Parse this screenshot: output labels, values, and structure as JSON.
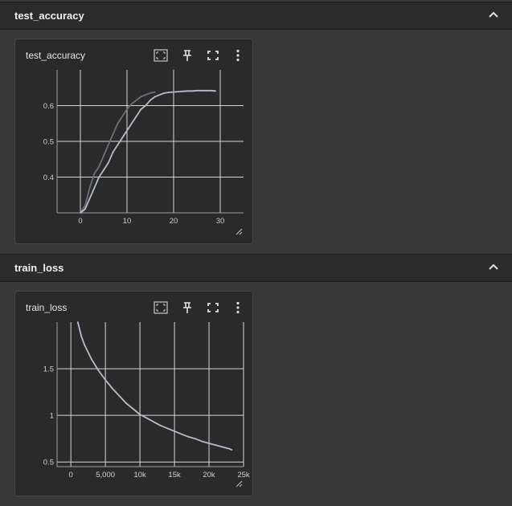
{
  "sections": [
    {
      "title": "test_accuracy"
    },
    {
      "title": "train_loss"
    }
  ],
  "cards": [
    {
      "title": "test_accuracy",
      "toolbar": {
        "fit": "fit-domain-icon",
        "pin": "pin-icon",
        "fullscreen": "fullscreen-icon",
        "more": "more-vert-icon"
      },
      "chart_data": {
        "type": "line",
        "title": "",
        "xlabel": "",
        "ylabel": "",
        "xlim": [
          -5,
          35
        ],
        "ylim": [
          0.3,
          0.7
        ],
        "xticks": [
          0,
          10,
          20,
          30
        ],
        "yticks": [
          0.4,
          0.5,
          0.6
        ],
        "grid": true,
        "series": [
          {
            "color": "#b4bdcb",
            "x": [
              0,
              1,
              2,
              3,
              4,
              5,
              6,
              7,
              8,
              9,
              10,
              11,
              12,
              13,
              14,
              15,
              16,
              17,
              18,
              19,
              20,
              21,
              22,
              23,
              24,
              25,
              26,
              27,
              28,
              29
            ],
            "y": [
              0.3,
              0.31,
              0.34,
              0.37,
              0.4,
              0.42,
              0.44,
              0.47,
              0.49,
              0.51,
              0.53,
              0.55,
              0.57,
              0.59,
              0.6,
              0.615,
              0.625,
              0.63,
              0.635,
              0.637,
              0.638,
              0.639,
              0.64,
              0.641,
              0.641,
              0.642,
              0.642,
              0.642,
              0.642,
              0.641
            ]
          },
          {
            "color": "#6d7178",
            "x": [
              0,
              1,
              2,
              3,
              4,
              5,
              6,
              7,
              8,
              9,
              10,
              11,
              12,
              13,
              14,
              15,
              16
            ],
            "y": [
              0.3,
              0.32,
              0.37,
              0.41,
              0.43,
              0.46,
              0.49,
              0.52,
              0.55,
              0.57,
              0.59,
              0.605,
              0.615,
              0.625,
              0.63,
              0.635,
              0.638
            ]
          }
        ]
      }
    },
    {
      "title": "train_loss",
      "toolbar": {
        "fit": "fit-domain-icon",
        "pin": "pin-icon",
        "fullscreen": "fullscreen-icon",
        "more": "more-vert-icon"
      },
      "chart_data": {
        "type": "line",
        "title": "",
        "xlabel": "",
        "ylabel": "",
        "xlim": [
          -2000,
          25000
        ],
        "ylim": [
          0.45,
          2.0
        ],
        "xticks": [
          0,
          5000,
          10000,
          15000,
          20000,
          25000
        ],
        "xtick_labels": [
          "0",
          "5,000",
          "10k",
          "15k",
          "20k",
          "25k"
        ],
        "yticks": [
          0.5,
          1,
          1.5
        ],
        "ytick_labels": [
          "0.5",
          "1",
          "1.5"
        ],
        "grid": true,
        "series": [
          {
            "color": "#b4bdcb",
            "x": [
              1000,
              1500,
              2000,
              3000,
              4000,
              5000,
              6000,
              7000,
              8000,
              9000,
              10000,
              11000,
              12000,
              13000,
              14000,
              15000,
              16000,
              17000,
              18000,
              19000,
              20000,
              21000,
              22000,
              23000,
              23300
            ],
            "y": [
              2.0,
              1.85,
              1.75,
              1.6,
              1.48,
              1.38,
              1.29,
              1.21,
              1.13,
              1.07,
              1.01,
              0.97,
              0.93,
              0.89,
              0.86,
              0.83,
              0.8,
              0.77,
              0.75,
              0.72,
              0.7,
              0.68,
              0.66,
              0.64,
              0.63
            ]
          }
        ]
      }
    }
  ]
}
